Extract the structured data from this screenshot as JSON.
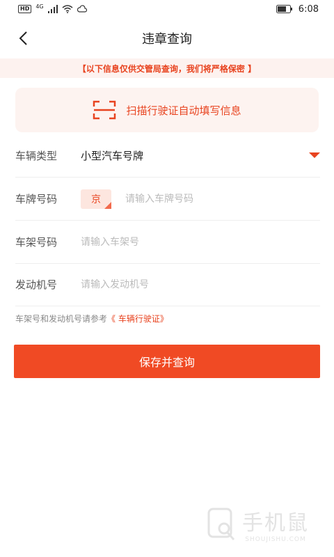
{
  "status_bar": {
    "hd": "HD",
    "network": "4G",
    "time": "6:08"
  },
  "nav": {
    "title": "违章查询"
  },
  "notice": {
    "text": "【以下信息仅供交管局查询，我们将严格保密 】"
  },
  "scan": {
    "label": "扫描行驶证自动填写信息"
  },
  "form": {
    "vehicle_type": {
      "label": "车辆类型",
      "value": "小型汽车号牌"
    },
    "plate_number": {
      "label": "车牌号码",
      "province": "京",
      "placeholder": "请输入车牌号码"
    },
    "frame_number": {
      "label": "车架号码",
      "placeholder": "请输入车架号"
    },
    "engine_number": {
      "label": "发动机号",
      "placeholder": "请输入发动机号"
    }
  },
  "hint": {
    "text": "车架号和发动机号请参考",
    "link": "《 车辆行驶证》"
  },
  "submit": {
    "label": "保存并查询"
  },
  "watermark": {
    "cn": "手机鼠",
    "en": "SHOUJISHU.COM"
  },
  "colors": {
    "accent": "#f04a24",
    "accent_light": "#fdf3f0"
  }
}
